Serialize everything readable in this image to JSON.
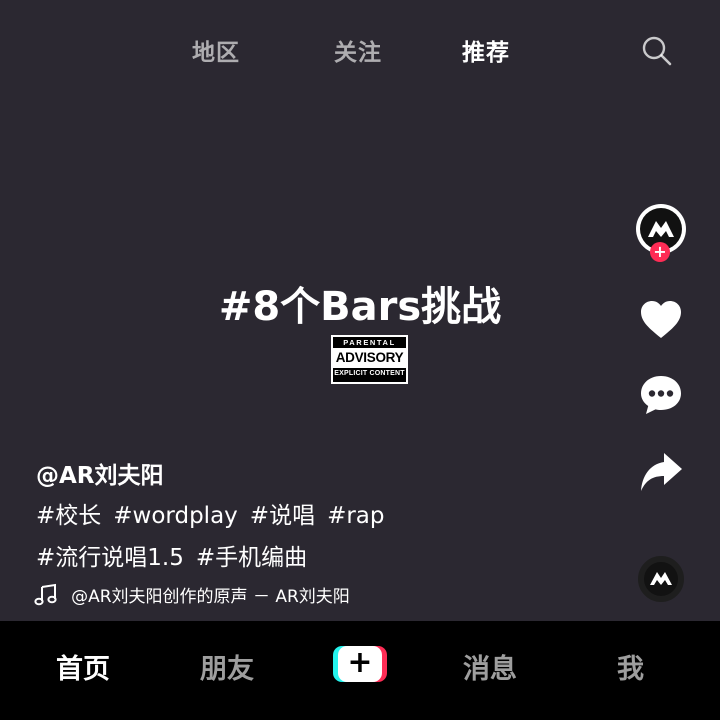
{
  "top_tabs": [
    {
      "label": "地区",
      "active": false
    },
    {
      "label": "关注",
      "active": false
    },
    {
      "label": "推荐",
      "active": true
    }
  ],
  "search_icon": "search-icon",
  "video": {
    "title": "#8个Bars挑战",
    "advisory": {
      "line1": "PARENTAL",
      "line2": "ADVISORY",
      "line3": "EXPLICIT CONTENT"
    }
  },
  "creator": {
    "avatar_text": "AR",
    "follow_label": "+"
  },
  "actions": {
    "like_icon": "heart-icon",
    "comment_icon": "comment-icon",
    "share_icon": "share-icon",
    "music_disc_text": "AR"
  },
  "caption": {
    "author": "@AR刘夫阳",
    "tags_line1": [
      "#校长",
      "#wordplay",
      "#说唱",
      "#rap"
    ],
    "tags_line2": [
      "#流行说唱1.5",
      "#手机编曲"
    ],
    "music": "@AR刘夫阳创作的原声 － AR刘夫阳"
  },
  "bottom_nav": {
    "home": "首页",
    "friends": "朋友",
    "create": "+",
    "messages": "消息",
    "me": "我"
  },
  "colors": {
    "background": "#2b2831",
    "nav_background": "#000000",
    "accent_red": "#fe2c55",
    "accent_cyan": "#25f4ee"
  }
}
